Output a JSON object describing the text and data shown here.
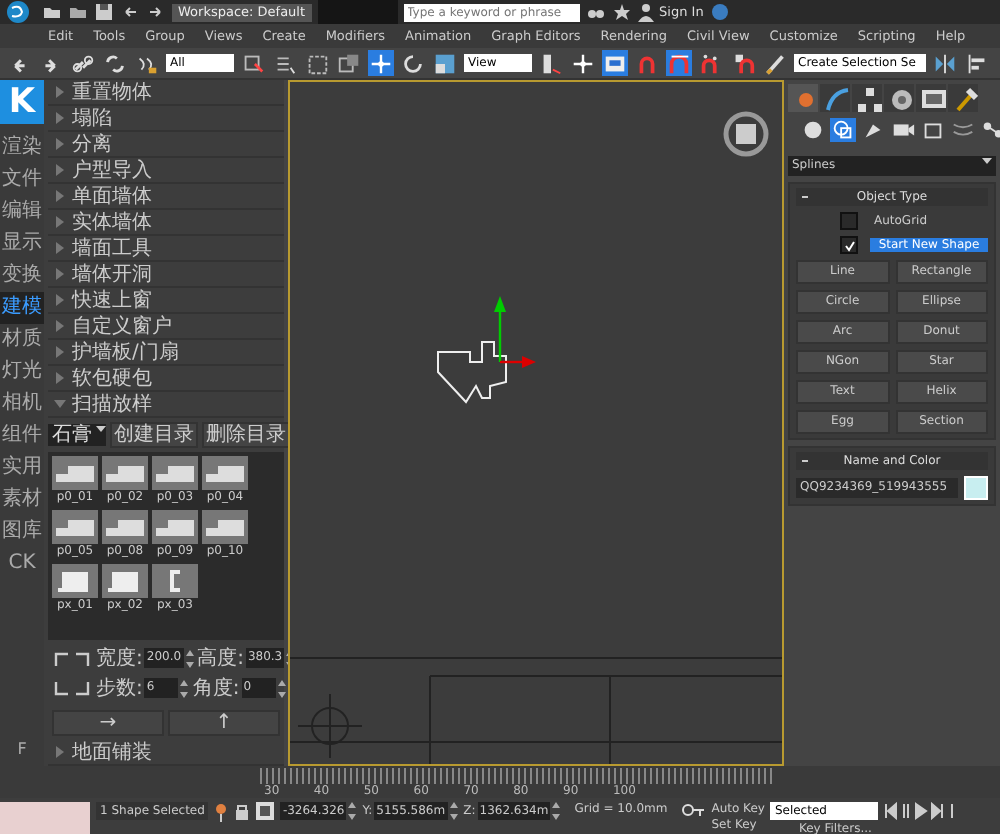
{
  "title_bar": {
    "workspace": "Workspace: Default",
    "search": {
      "placeholder": "Type a keyword or phrase"
    },
    "sign_in": "Sign In"
  },
  "menu": [
    "Edit",
    "Tools",
    "Group",
    "Views",
    "Create",
    "Modifiers",
    "Animation",
    "Graph Editors",
    "Rendering",
    "Civil View",
    "Customize",
    "Scripting",
    "Help"
  ],
  "toolbar": [
    {
      "kind": "undo",
      "selected": false
    },
    {
      "kind": "redo",
      "selected": false
    },
    {
      "kind": "link",
      "selected": false
    },
    {
      "kind": "unlink",
      "selected": false
    },
    {
      "kind": "bind",
      "selected": false
    },
    {
      "kind": "dropdown",
      "value": "All"
    },
    {
      "kind": "select",
      "selected": false
    },
    {
      "kind": "select-list",
      "selected": false
    },
    {
      "kind": "rect-select",
      "selected": false
    },
    {
      "kind": "window",
      "selected": false
    },
    {
      "kind": "move",
      "selected": true
    },
    {
      "kind": "rotate",
      "selected": false
    },
    {
      "kind": "scale",
      "selected": false
    },
    {
      "kind": "dropdown",
      "value": "View"
    },
    {
      "kind": "pivot",
      "selected": false
    },
    {
      "kind": "move",
      "selected": false
    },
    {
      "kind": "manipulate",
      "selected": true
    },
    {
      "kind": "snap",
      "selected": false
    },
    {
      "kind": "angle-snap",
      "selected": true
    },
    {
      "kind": "percent-snap",
      "selected": false
    },
    {
      "kind": "spinner-snap",
      "selected": false
    },
    {
      "kind": "edit-set",
      "selected": false
    },
    {
      "kind": "dropdown",
      "value": "Create Selection Se"
    },
    {
      "kind": "mirror",
      "selected": false
    },
    {
      "kind": "align",
      "selected": false
    }
  ],
  "plugin": {
    "logo": "K",
    "tabs": [
      {
        "label": "渲染",
        "selected": false
      },
      {
        "label": "文件",
        "selected": false
      },
      {
        "label": "编辑",
        "selected": false
      },
      {
        "label": "显示",
        "selected": false
      },
      {
        "label": "变换",
        "selected": false
      },
      {
        "label": "建模",
        "selected": true
      },
      {
        "label": "材质",
        "selected": false
      },
      {
        "label": "灯光",
        "selected": false
      },
      {
        "label": "相机",
        "selected": false
      },
      {
        "label": "组件",
        "selected": false
      },
      {
        "label": "实用",
        "selected": false
      },
      {
        "label": "素材",
        "selected": false
      },
      {
        "label": "图库",
        "selected": false
      },
      {
        "label": "CK",
        "selected": false
      }
    ],
    "footer": "F"
  },
  "panel": {
    "items": [
      {
        "label": "重置物体",
        "expanded": false
      },
      {
        "label": "塌陷",
        "expanded": false
      },
      {
        "label": "分离",
        "expanded": false
      },
      {
        "label": "户型导入",
        "expanded": false
      },
      {
        "label": "单面墙体",
        "expanded": false
      },
      {
        "label": "实体墙体",
        "expanded": false
      },
      {
        "label": "墙面工具",
        "expanded": false
      },
      {
        "label": "墙体开洞",
        "expanded": false
      },
      {
        "label": "快速上窗",
        "expanded": false
      },
      {
        "label": "自定义窗户",
        "expanded": false
      },
      {
        "label": "护墙板/门扇",
        "expanded": false
      },
      {
        "label": "软包硬包",
        "expanded": false
      },
      {
        "label": "扫描放样",
        "expanded": true
      }
    ],
    "category": "石膏",
    "buttons": [
      "创建目录",
      "删除目录"
    ],
    "thumbnails": [
      {
        "label": "p0_01",
        "kind": "profile"
      },
      {
        "label": "p0_02",
        "kind": "profile"
      },
      {
        "label": "p0_03",
        "kind": "profile"
      },
      {
        "label": "p0_04",
        "kind": "profile"
      },
      {
        "label": "p0_05",
        "kind": "profile"
      },
      {
        "label": "p0_08",
        "kind": "profile"
      },
      {
        "label": "p0_09",
        "kind": "profile"
      },
      {
        "label": "p0_10",
        "kind": "profile"
      },
      {
        "label": "px_01",
        "kind": "corner"
      },
      {
        "label": "px_02",
        "kind": "corner"
      },
      {
        "label": "px_03",
        "kind": "bracket"
      }
    ],
    "params": [
      {
        "label": "宽度:",
        "value": "200.0"
      },
      {
        "label": "高度:",
        "value": "380.3"
      },
      {
        "label": "步数:",
        "value": "6"
      },
      {
        "label": "角度:",
        "value": "0"
      }
    ],
    "arrows": [
      "→",
      "↑"
    ],
    "sections": [
      "地面铺装"
    ]
  },
  "command_panel": {
    "tabs": [
      {
        "kind": "create",
        "selected": true
      },
      {
        "kind": "modify",
        "selected": false
      },
      {
        "kind": "hierarchy",
        "selected": false
      },
      {
        "kind": "motion",
        "selected": false
      },
      {
        "kind": "display",
        "selected": false
      },
      {
        "kind": "utilities",
        "selected": false
      }
    ],
    "categories": [
      {
        "kind": "geometry",
        "selected": false
      },
      {
        "kind": "shapes",
        "selected": true
      },
      {
        "kind": "lights",
        "selected": false
      },
      {
        "kind": "cameras",
        "selected": false
      },
      {
        "kind": "helpers",
        "selected": false
      },
      {
        "kind": "spacewarps",
        "selected": false
      },
      {
        "kind": "systems",
        "selected": false
      }
    ],
    "type": "Splines",
    "object_type": {
      "title": "Object Type",
      "options": [
        {
          "label": "AutoGrid",
          "checked": false
        },
        {
          "label": "Start New Shape",
          "checked": true
        }
      ],
      "buttons": [
        "Line",
        "Rectangle",
        "Circle",
        "Ellipse",
        "Arc",
        "Donut",
        "NGon",
        "Star",
        "Text",
        "Helix",
        "Egg",
        "Section"
      ]
    },
    "name_and_color": {
      "title": "Name and Color",
      "name": "QQ9234369_519943555",
      "color": "#c8eef0"
    }
  },
  "timeline": {
    "ticks": [
      "30",
      "40",
      "50",
      "60",
      "70",
      "80",
      "90",
      "100"
    ]
  },
  "status": {
    "selection": "1 Shape Selected",
    "coords": [
      {
        "value": "-3264.326"
      },
      {
        "label": "Y:",
        "value": "5155.586m"
      },
      {
        "label": "Z:",
        "value": "1362.634m"
      }
    ],
    "grid": "Grid = 10.0mm",
    "auto_key": "Auto Key",
    "key_mode": "Selected",
    "set_key": "Set Key",
    "key_filters": "Key Filters..."
  }
}
